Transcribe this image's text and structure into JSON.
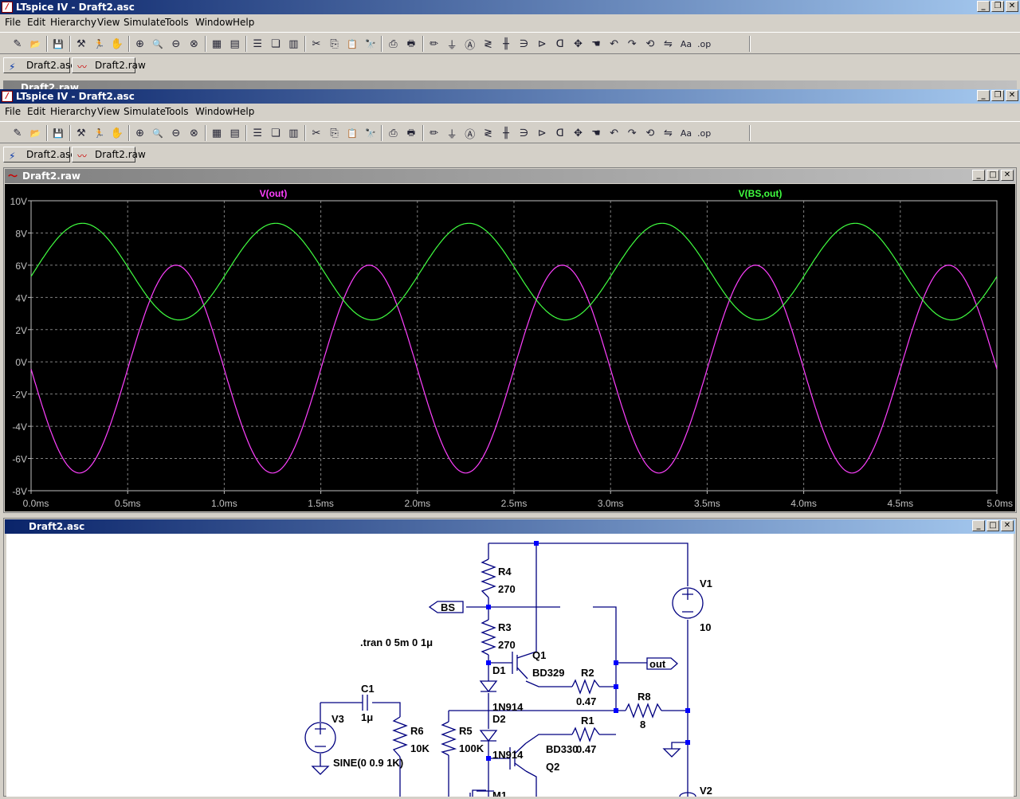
{
  "app": {
    "title": "LTspice IV - Draft2.asc"
  },
  "menu": [
    "File",
    "Edit",
    "Hierarchy",
    "View",
    "Simulate",
    "Tools",
    "Window",
    "Help"
  ],
  "tabs": [
    {
      "label": "Draft2.asc",
      "icon": "schematic-icon"
    },
    {
      "label": "Draft2.raw",
      "icon": "waveform-icon"
    }
  ],
  "background_window": {
    "title": "Draft2.raw"
  },
  "waveform_window": {
    "title": "Draft2.raw"
  },
  "schematic_window": {
    "title": "Draft2.asc"
  },
  "chart_data": {
    "type": "line",
    "xlim": [
      0,
      5
    ],
    "ylim": [
      -8,
      10
    ],
    "x_ticks": [
      "0.0ms",
      "0.5ms",
      "1.0ms",
      "1.5ms",
      "2.0ms",
      "2.5ms",
      "3.0ms",
      "3.5ms",
      "4.0ms",
      "4.5ms",
      "5.0ms"
    ],
    "y_ticks": [
      "10V",
      "8V",
      "6V",
      "4V",
      "2V",
      "0V",
      "-2V",
      "-4V",
      "-6V",
      "-8V"
    ],
    "grid": true,
    "series": [
      {
        "name": "V(out)",
        "color": "#ff40ff",
        "waveform": "sine",
        "frequency_khz": 1,
        "offset": -0.45,
        "amplitude": 6.45,
        "phase": "inverted",
        "x": [
          0,
          0.25,
          0.5,
          0.75,
          1.0
        ],
        "y": [
          0,
          -6.9,
          -0.45,
          6.0,
          -0.45
        ]
      },
      {
        "name": "V(BS,out)",
        "color": "#40ff40",
        "waveform": "sine",
        "frequency_khz": 1,
        "offset": 5.6,
        "amplitude": 3.0,
        "x": [
          0,
          0.25,
          0.5,
          0.75,
          1.0
        ],
        "y": [
          5.3,
          8.6,
          5.6,
          2.6,
          5.6
        ]
      }
    ]
  },
  "schematic": {
    "directive": ".tran 0 5m 0 1μ",
    "labels": {
      "R4": "R4",
      "R4v": "270",
      "R3": "R3",
      "R3v": "270",
      "BS": "BS",
      "V1": "V1",
      "V1v": "10",
      "Q1": "Q1",
      "Q1m": "BD329",
      "D1": "D1",
      "D1m": "1N914",
      "R2": "R2",
      "R2v": "0.47",
      "out": "out",
      "R8": "R8",
      "R8v": "8",
      "C1": "C1",
      "C1v": "1μ",
      "V3": "V3",
      "R6": "R6",
      "R6v": "10K",
      "R5": "R5",
      "R5v": "100K",
      "D2": "D2",
      "D2m": "1N914",
      "R1": "R1",
      "R1v": "0.47",
      "Q2m": "BD330",
      "Q2": "Q2",
      "V3v": "SINE(0 0.9 1K)",
      "V2": "V2",
      "M1": "M1"
    }
  }
}
